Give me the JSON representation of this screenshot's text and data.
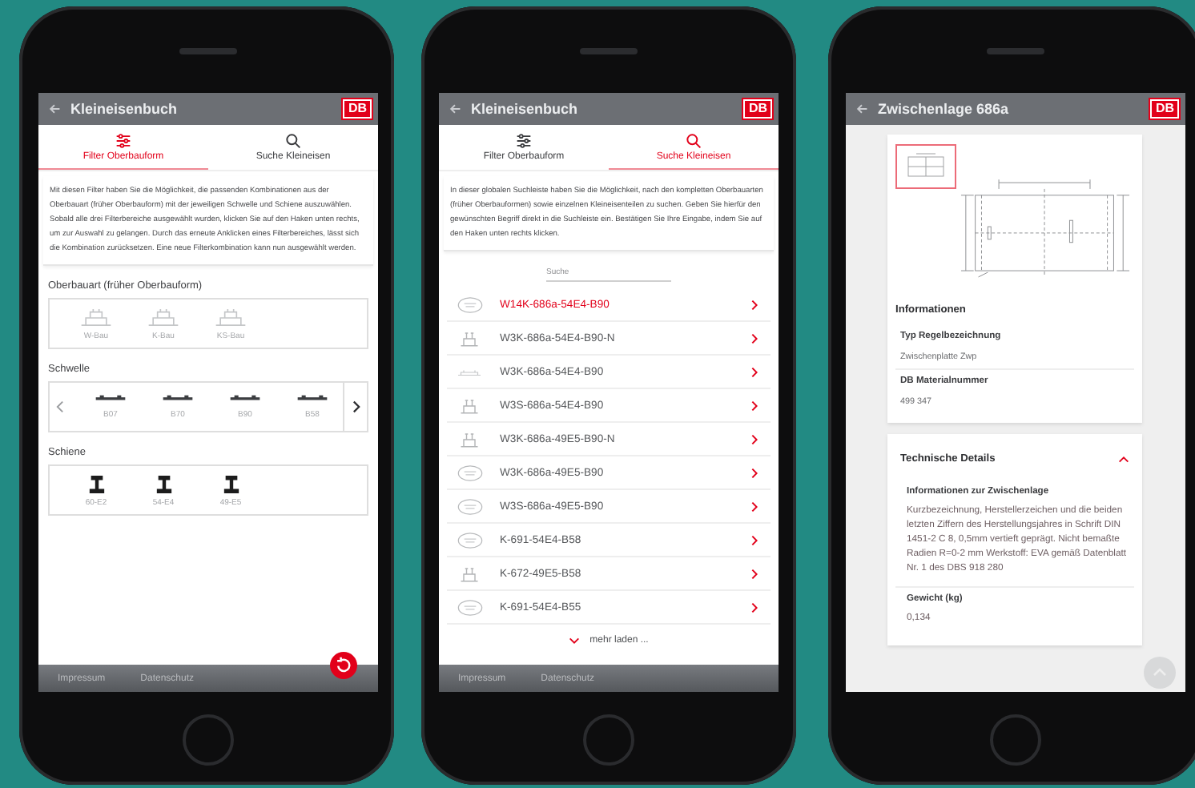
{
  "phones": [
    {
      "kind": "filter",
      "header": {
        "title": "Kleineisenbuch",
        "logo": "DB"
      },
      "tabs": [
        {
          "label": "Filter Oberbauform",
          "selected": true
        },
        {
          "label": "Suche Kleineisen",
          "selected": false
        }
      ],
      "intro": "Mit diesen Filter haben Sie die Möglichkeit, die passenden Kombinationen aus der Oberbauart (früher Oberbauform) mit der jeweiligen Schwelle und Schiene auszuwählen. Sobald alle drei Filterbereiche ausgewählt wurden, klicken Sie auf den Haken unten rechts, um zur Auswahl zu gelangen. Durch das erneute Anklicken eines Filterbereiches, lässt sich die Kombination zurücksetzen. Eine neue Filterkombination kann nun ausgewählt werden.",
      "sections": [
        {
          "title": "Oberbauart (früher Oberbauform)",
          "kind": "structure",
          "scroll_arrows": false,
          "items": [
            "W-Bau",
            "K-Bau",
            "KS-Bau"
          ]
        },
        {
          "title": "Schwelle",
          "kind": "sleeper",
          "scroll_arrows": true,
          "items": [
            "B07",
            "B70",
            "B90",
            "B58"
          ]
        },
        {
          "title": "Schiene",
          "kind": "rail",
          "scroll_arrows": false,
          "items": [
            "60-E2",
            "54-E4",
            "49-E5"
          ]
        }
      ],
      "reset_button": true,
      "footer": [
        "Impressum",
        "Datenschutz"
      ]
    },
    {
      "kind": "search",
      "header": {
        "title": "Kleineisenbuch",
        "logo": "DB"
      },
      "tabs": [
        {
          "label": "Filter Oberbauform",
          "selected": false
        },
        {
          "label": "Suche Kleineisen",
          "selected": true
        }
      ],
      "intro": "In dieser globalen Suchleiste haben Sie die Möglichkeit, nach den kompletten Oberbauarten (früher Oberbauformen) sowie einzelnen Kleineisenteilen zu suchen. Geben Sie hierfür den gewünschten Begriff direkt in die Suchleiste ein. Bestätigen Sie Ihre Eingabe, indem Sie auf den Haken unten rechts klicken.",
      "search": {
        "placeholder": "Suche"
      },
      "results": [
        {
          "label": "W14K-686a-54E4-B90",
          "kind": "disc",
          "selected": true
        },
        {
          "label": "W3K-686a-54E4-B90-N",
          "kind": "fastener",
          "selected": false
        },
        {
          "label": "W3K-686a-54E4-B90",
          "kind": "plate",
          "selected": false
        },
        {
          "label": "W3S-686a-54E4-B90",
          "kind": "fastener",
          "selected": false
        },
        {
          "label": "W3K-686a-49E5-B90-N",
          "kind": "fastener",
          "selected": false
        },
        {
          "label": "W3K-686a-49E5-B90",
          "kind": "disc",
          "selected": false
        },
        {
          "label": "W3S-686a-49E5-B90",
          "kind": "disc",
          "selected": false
        },
        {
          "label": "K-691-54E4-B58",
          "kind": "disc",
          "selected": false
        },
        {
          "label": "K-672-49E5-B58",
          "kind": "fastener",
          "selected": false
        },
        {
          "label": "K-691-54E4-B55",
          "kind": "disc",
          "selected": false
        }
      ],
      "more": "mehr laden ...",
      "footer": [
        "Impressum",
        "Datenschutz"
      ]
    },
    {
      "kind": "detail",
      "header": {
        "title": "Zwischenlage 686a",
        "logo": "DB"
      },
      "thumbnails": [
        {
          "selected": true
        }
      ],
      "info": {
        "title": "Informationen",
        "fields": [
          {
            "label": "Typ Regelbezeichnung",
            "value": "Zwischenplatte Zwp"
          },
          {
            "label": "DB Materialnummer",
            "value": "499 347"
          }
        ]
      },
      "details": {
        "title": "Technische Details",
        "expanded": true,
        "fields": [
          {
            "label": "Informationen zur Zwischenlage",
            "value": "Kurzbezeichnung, Herstellerzeichen und die beiden letzten Ziffern des Herstellungsjahres in Schrift DIN 1451-2 C 8, 0,5mm vertieft geprägt. Nicht bemaßte Radien R=0-2 mm Werkstoff: EVA gemäß Datenblatt Nr. 1 des DBS 918 280"
          },
          {
            "label": "Gewicht (kg)",
            "value": "0,134"
          }
        ]
      },
      "scroll_top_button": true
    }
  ]
}
